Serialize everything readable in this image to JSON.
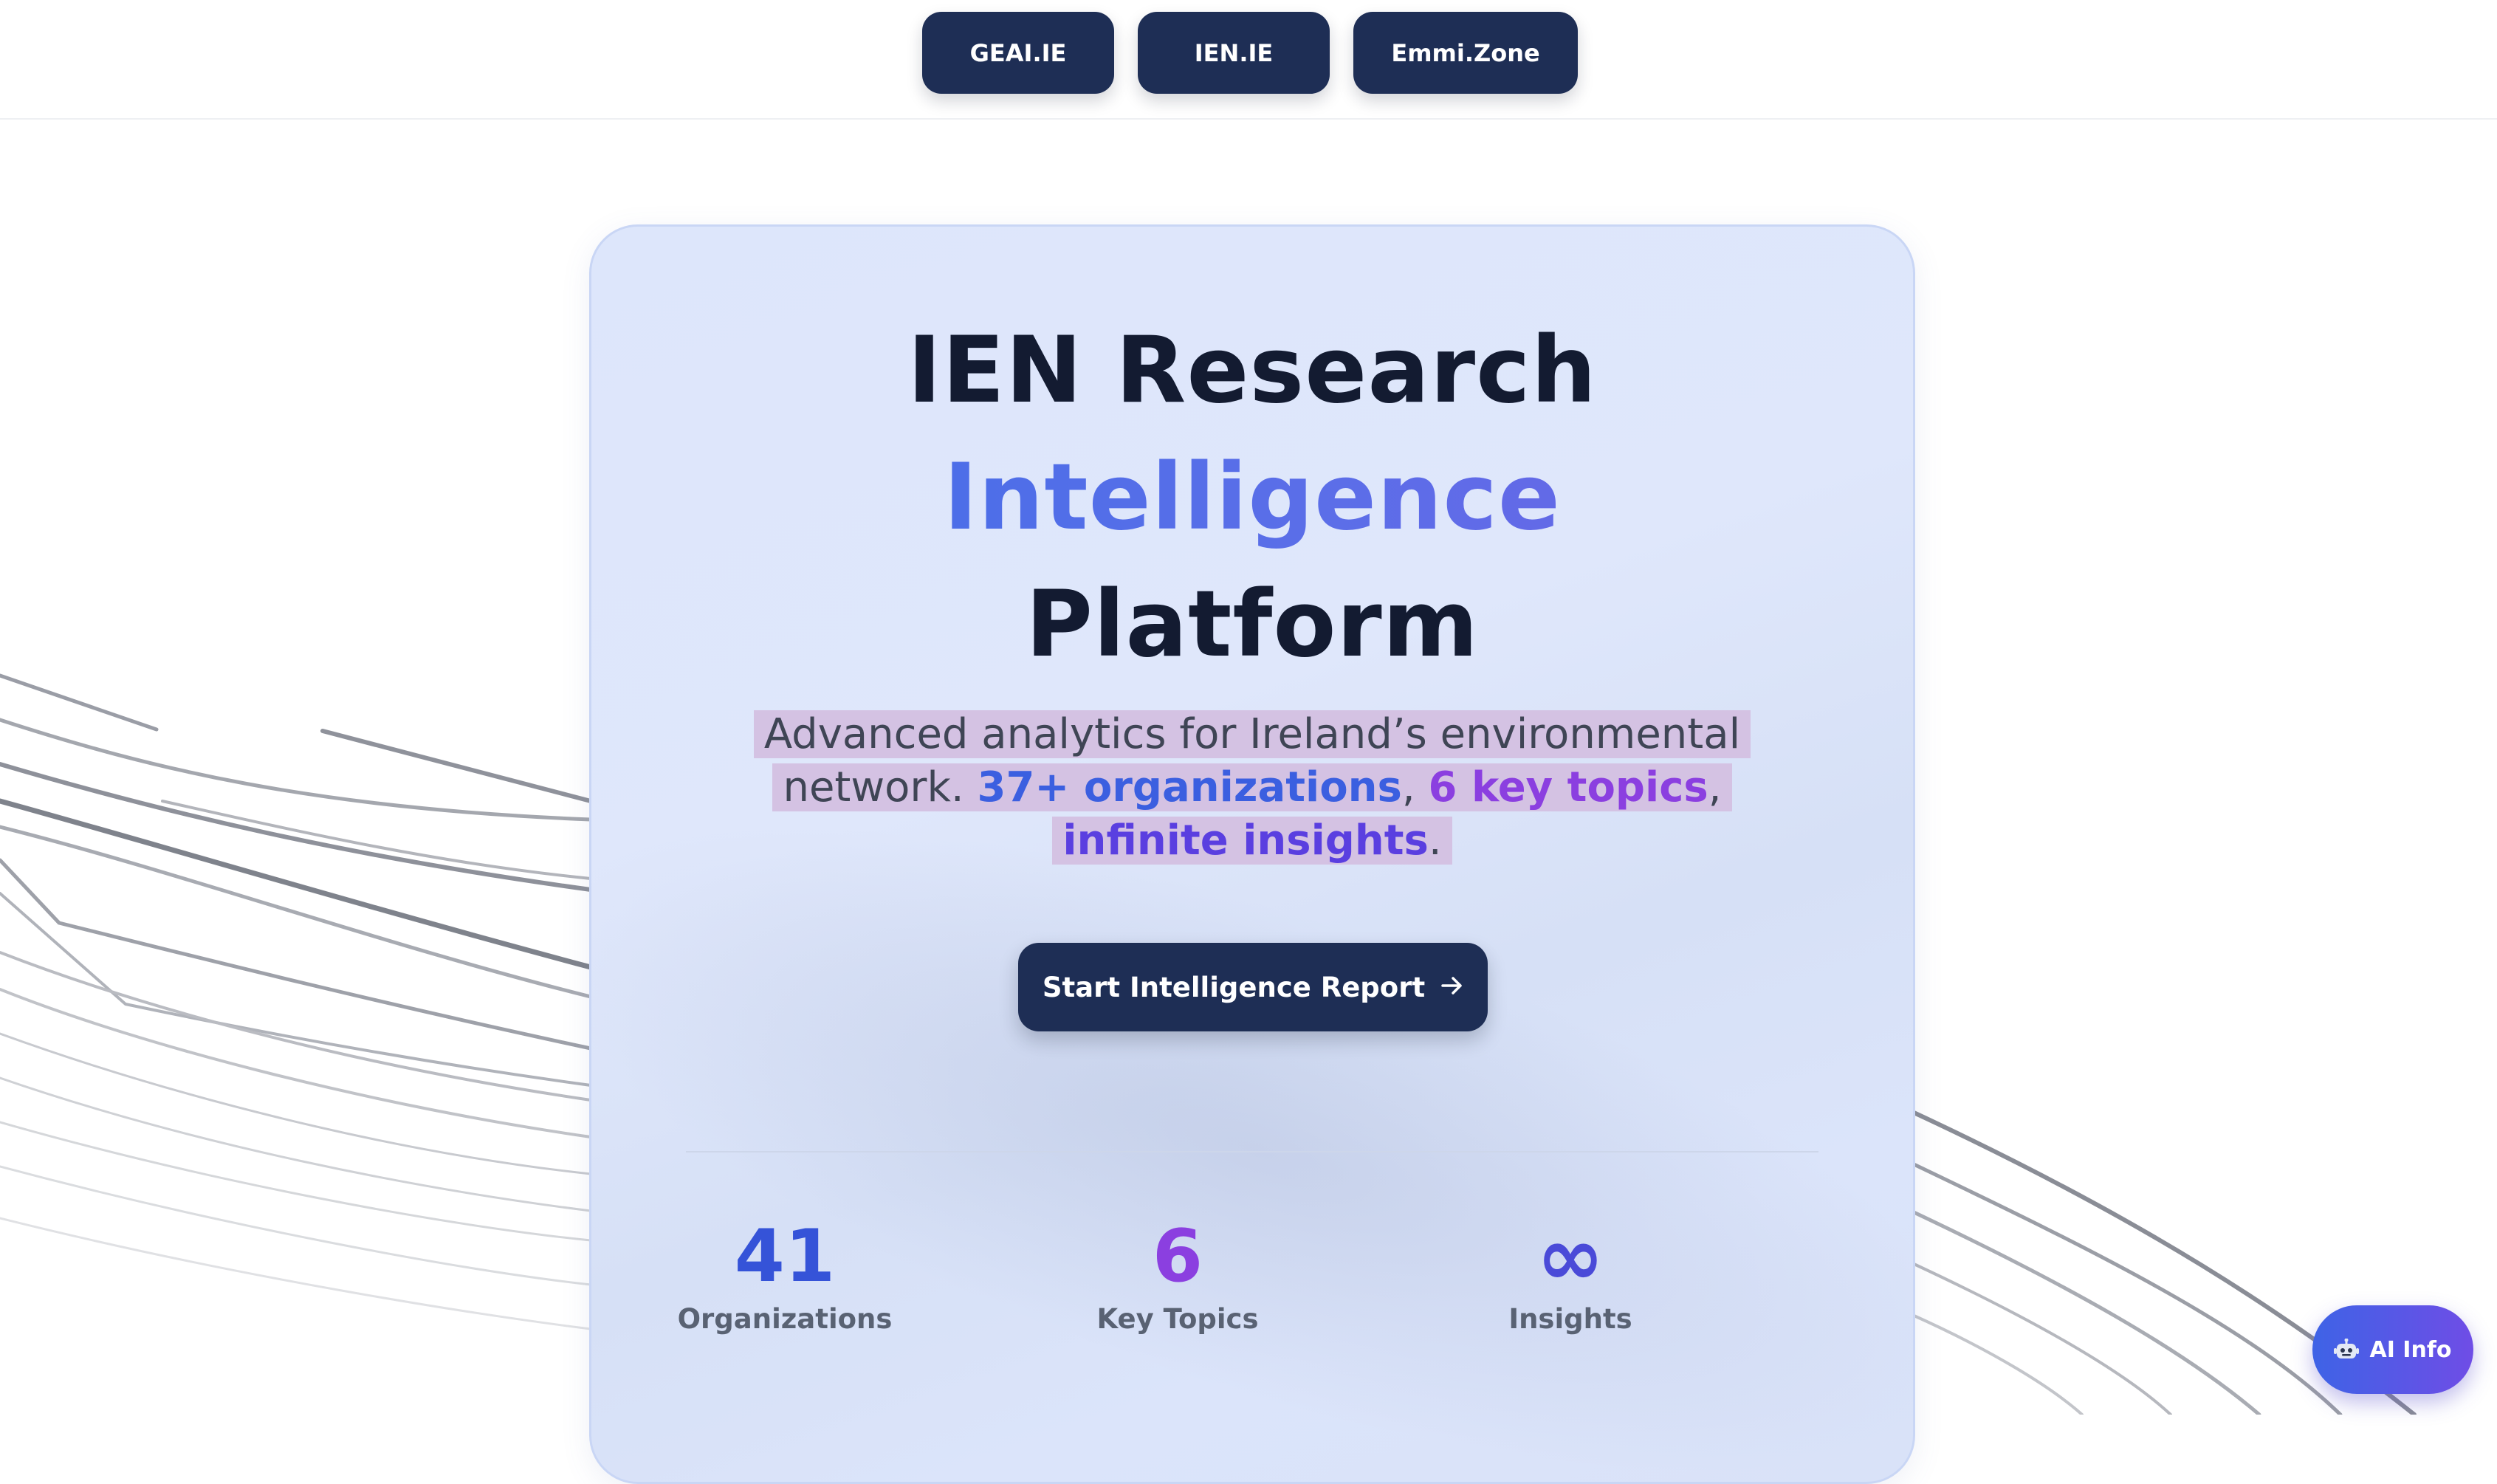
{
  "nav": {
    "items": [
      {
        "label": "GEAI.IE"
      },
      {
        "label": "IEN.IE"
      },
      {
        "label": "Emmi.Zone"
      }
    ]
  },
  "hero": {
    "title_line1": "IEN Research",
    "title_line2": "Intelligence",
    "title_line3": "Platform",
    "subtitle": {
      "text_a": "Advanced analytics for Ireland’s environmental network. ",
      "highlight_orgs": "37+ organizations",
      "sep1": ", ",
      "highlight_topics": "6 key topics",
      "sep2": ", ",
      "highlight_insights": "infinite insights",
      "end": "."
    },
    "cta": {
      "label": "Start Intelligence Report",
      "icon": "arrow-right-icon"
    },
    "stats": [
      {
        "value": "41",
        "label": "Organizations"
      },
      {
        "value": "6",
        "label": "Key Topics"
      },
      {
        "value": "∞",
        "label": "Insights"
      }
    ]
  },
  "ai_button": {
    "label": "AI Info",
    "icon": "robot-icon"
  },
  "colors": {
    "nav_bg": "#1e2e55",
    "card_bg": "#dde6fb",
    "accent_blue": "#3b5fe0",
    "accent_purple": "#8b3fe0",
    "highlight_bg": "#d4c2e3"
  }
}
